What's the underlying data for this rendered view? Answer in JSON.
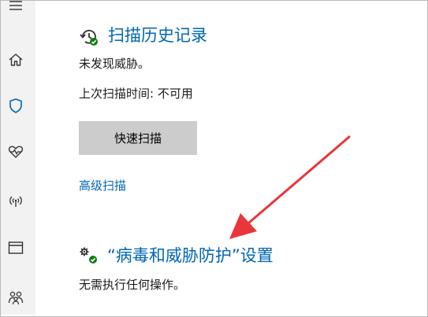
{
  "sidebar": {
    "items": [
      {
        "icon": "hamburger-menu-icon"
      },
      {
        "icon": "home-icon"
      },
      {
        "icon": "shield-icon"
      },
      {
        "icon": "heart-pulse-icon"
      },
      {
        "icon": "wireless-antenna-icon"
      },
      {
        "icon": "browser-window-icon"
      },
      {
        "icon": "family-icon"
      }
    ]
  },
  "history": {
    "title": "扫描历史记录",
    "status": "未发现威胁。",
    "last_scan": "上次扫描时间: 不可用"
  },
  "actions": {
    "quick_scan_label": "快速扫描",
    "advanced_scan_label": "高级扫描"
  },
  "settings": {
    "title": "“病毒和威胁防护”设置",
    "status": "无需执行任何操作。"
  },
  "colors": {
    "accent": "#0066b4",
    "ok_badge": "#107c10",
    "annotation_arrow": "#e8373a",
    "sidebar_bg": "#f2f2f2",
    "button_bg": "#cccccc"
  }
}
